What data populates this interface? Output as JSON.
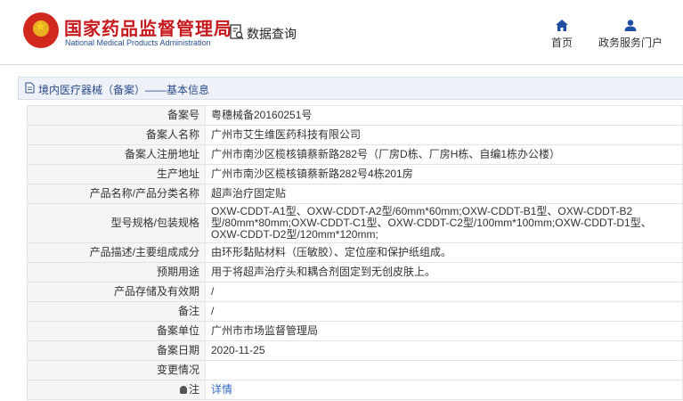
{
  "header": {
    "title": "国家药品监督管理局",
    "subtitle": "National Medical Products Administration",
    "query_label": "数据查询",
    "nav": [
      {
        "label": "首页",
        "icon": "home-icon"
      },
      {
        "label": "政务服务门户",
        "icon": "user-icon"
      }
    ]
  },
  "breadcrumb": {
    "text": "境内医疗器械（备案）——基本信息"
  },
  "details": {
    "rows": [
      {
        "label": "备案号",
        "value": "粤穗械备20160251号"
      },
      {
        "label": "备案人名称",
        "value": "广州市艾生维医药科技有限公司"
      },
      {
        "label": "备案人注册地址",
        "value": "广州市南沙区榄核镇蔡新路282号（厂房D栋、厂房H栋、自编1栋办公楼）"
      },
      {
        "label": "生产地址",
        "value": "广州市南沙区榄核镇蔡新路282号4栋201房"
      },
      {
        "label": "产品名称/产品分类名称",
        "value": "超声治疗固定贴"
      },
      {
        "label": "型号规格/包装规格",
        "value": "OXW-CDDT-A1型、OXW-CDDT-A2型/60mm*60mm;OXW-CDDT-B1型、OXW-CDDT-B2型/80mm*80mm;OXW-CDDT-C1型、OXW-CDDT-C2型/100mm*100mm;OXW-CDDT-D1型、OXW-CDDT-D2型/120mm*120mm;"
      },
      {
        "label": "产品描述/主要组成成分",
        "value": "由环形黏贴材料（压敏胶）、定位座和保护纸组成。"
      },
      {
        "label": "预期用途",
        "value": "用于将超声治疗头和耦合剂固定到无创皮肤上。"
      },
      {
        "label": "产品存储及有效期",
        "value": "/"
      },
      {
        "label": "备注",
        "value": "/"
      },
      {
        "label": "备案单位",
        "value": "广州市市场监督管理局"
      },
      {
        "label": "备案日期",
        "value": "2020-11-25"
      },
      {
        "label": "变更情况",
        "value": ""
      },
      {
        "label": "注",
        "value": "详情",
        "icon": "bulb-icon"
      }
    ]
  },
  "colors": {
    "brand_red": "#c6191e",
    "nav_blue": "#2b4a8b",
    "link_blue": "#3068c8"
  }
}
